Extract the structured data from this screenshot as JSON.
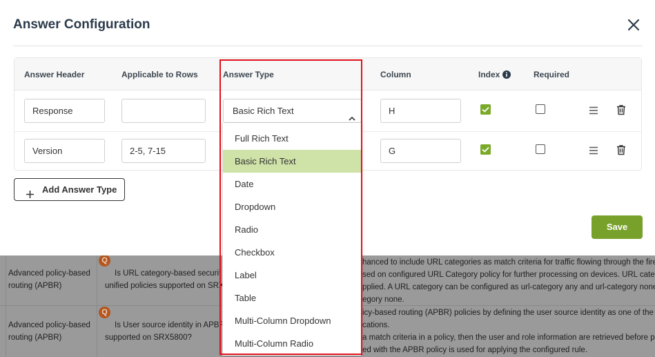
{
  "modal": {
    "title": "Answer Configuration",
    "close_icon": "close-icon",
    "columns": {
      "answer_header": "Answer Header",
      "applicable_to_rows": "Applicable to Rows",
      "answer_type": "Answer Type",
      "column": "Column",
      "index": "Index",
      "required": "Required"
    },
    "rows": [
      {
        "answer_header": "Response",
        "applicable_to_rows": "",
        "answer_type": "Basic Rich Text",
        "column": "H",
        "index": true,
        "required": false
      },
      {
        "answer_header": "Version",
        "applicable_to_rows": "2-5, 7-15",
        "answer_type": "",
        "column": "G",
        "index": true,
        "required": false
      }
    ],
    "add_button_label": "Add Answer Type",
    "save_button_label": "Save"
  },
  "dropdown": {
    "options": [
      "Full Rich Text",
      "Basic Rich Text",
      "Date",
      "Dropdown",
      "Radio",
      "Checkbox",
      "Label",
      "Table",
      "Multi-Column Dropdown",
      "Multi-Column Radio"
    ],
    "selected": "Basic Rich Text"
  },
  "background": {
    "rows": [
      {
        "category_line1": "Advanced policy-based",
        "category_line2": "routing (APBR)",
        "question_line1": "Is URL category-based securit",
        "question_line2": "unified policies supported on SRX",
        "answer_line1": "hanced to include URL categories as match criteria for traffic flowing through the firev",
        "answer_line2": "sed on configured URL Category policy for further processing on devices. URL categor",
        "answer_line3": "pplied. A URL category can be configured as url-category any and url-category none.",
        "answer_line4": "egory none."
      },
      {
        "category_line1": "Advanced policy-based",
        "category_line2": "routing (APBR)",
        "question_line1": "Is User source identity in APBR",
        "question_line2": "supported on SRX5800?",
        "answer_line1": "icy-based routing (APBR) policies by defining the user source identity as one of the ma",
        "answer_line2": "cations.",
        "answer_line3": "a match criteria in a policy, then the user and role information are retrieved before po",
        "answer_line4": "ed with the APBR policy is used for applying the configured rule."
      }
    ],
    "badge_letter": "Q"
  },
  "colors": {
    "accent_green": "#78a12b",
    "checkbox_green": "#7aaa2a",
    "selected_option_bg": "#cfe2a8",
    "highlight_red": "#e0101a"
  }
}
